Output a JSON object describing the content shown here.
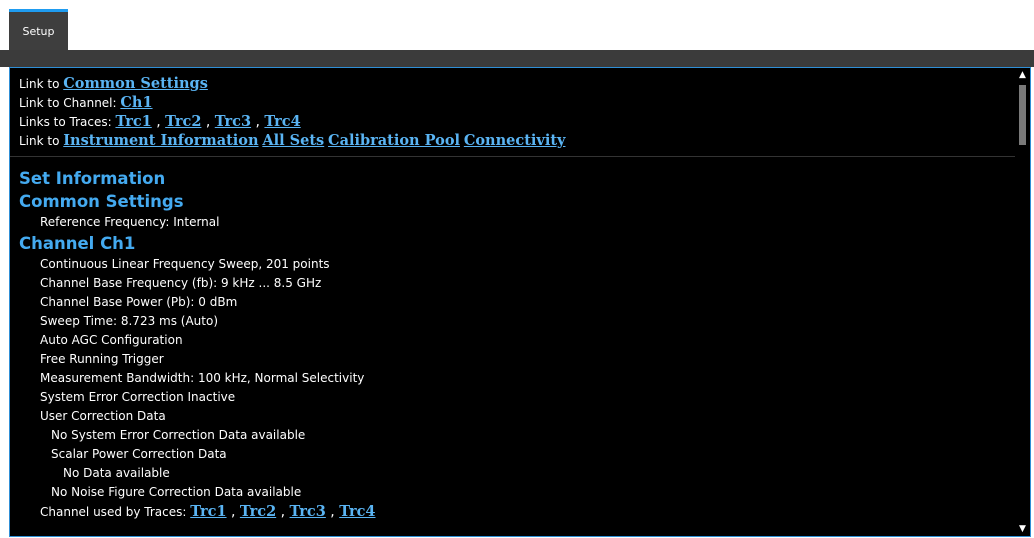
{
  "tabs": [
    {
      "label": "Setup"
    }
  ],
  "links": {
    "common": {
      "prefix": "Link to ",
      "label": "Common Settings"
    },
    "channel": {
      "prefix": "Link to Channel: ",
      "label": "Ch1"
    },
    "traces": {
      "prefix": "Links to Traces: ",
      "items": [
        "Trc1",
        "Trc2",
        "Trc3",
        "Trc4"
      ],
      "separator": ","
    },
    "other": {
      "prefix": "Link to ",
      "items": [
        "Instrument Information",
        "All Sets",
        "Calibration Pool",
        "Connectivity"
      ]
    }
  },
  "set_information": {
    "heading": "Set Information"
  },
  "common_settings": {
    "heading": "Common Settings",
    "items": [
      "Reference Frequency: Internal"
    ]
  },
  "channel": {
    "heading": "Channel Ch1",
    "items": [
      "Continuous Linear Frequency Sweep, 201 points",
      "Channel Base Frequency (fb): 9 kHz ... 8.5 GHz",
      "Channel Base Power (Pb): 0 dBm",
      "Sweep Time: 8.723 ms (Auto)",
      "Auto AGC Configuration",
      "Free Running Trigger",
      "Measurement Bandwidth: 100 kHz, Normal Selectivity",
      "System Error Correction Inactive",
      "User Correction Data"
    ],
    "sub_items": {
      "no_sys": "No System Error Correction Data available",
      "scalar": "Scalar Power Correction Data",
      "no_data": "No Data available",
      "no_noise": "No Noise Figure Correction Data available"
    },
    "used_by": {
      "prefix": "Channel used by Traces: ",
      "items": [
        "Trc1",
        "Trc2",
        "Trc3",
        "Trc4"
      ]
    }
  },
  "scrollbar": {
    "up_icon": "▲",
    "down_icon": "▼"
  }
}
